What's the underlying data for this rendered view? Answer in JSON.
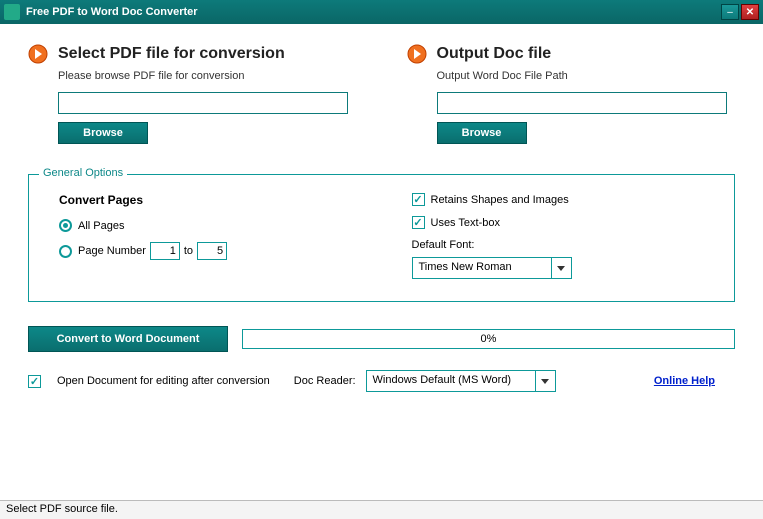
{
  "window": {
    "title": "Free PDF to Word Doc Converter"
  },
  "input_section": {
    "heading": "Select PDF file for conversion",
    "hint": "Please browse PDF file for conversion",
    "value": "",
    "browse_label": "Browse"
  },
  "output_section": {
    "heading": "Output Doc file",
    "hint": "Output Word Doc File Path",
    "value": "",
    "browse_label": "Browse"
  },
  "options": {
    "legend": "General Options",
    "pages_heading": "Convert Pages",
    "all_pages_label": "All Pages",
    "page_number_label": "Page Number",
    "page_from": "1",
    "page_to_label": "to",
    "page_to": "5",
    "selected_radio": "all",
    "retain_shapes_label": "Retains Shapes and Images",
    "retain_shapes_checked": true,
    "uses_textbox_label": "Uses Text-box",
    "uses_textbox_checked": true,
    "default_font_label": "Default Font:",
    "default_font_value": "Times New Roman"
  },
  "actions": {
    "convert_label": "Convert to Word Document",
    "progress_text": "0%",
    "open_after_label": "Open Document for editing after conversion",
    "open_after_checked": true,
    "doc_reader_label": "Doc Reader:",
    "doc_reader_value": "Windows Default (MS Word)",
    "help_label": "Online Help"
  },
  "status": "Select PDF source file."
}
